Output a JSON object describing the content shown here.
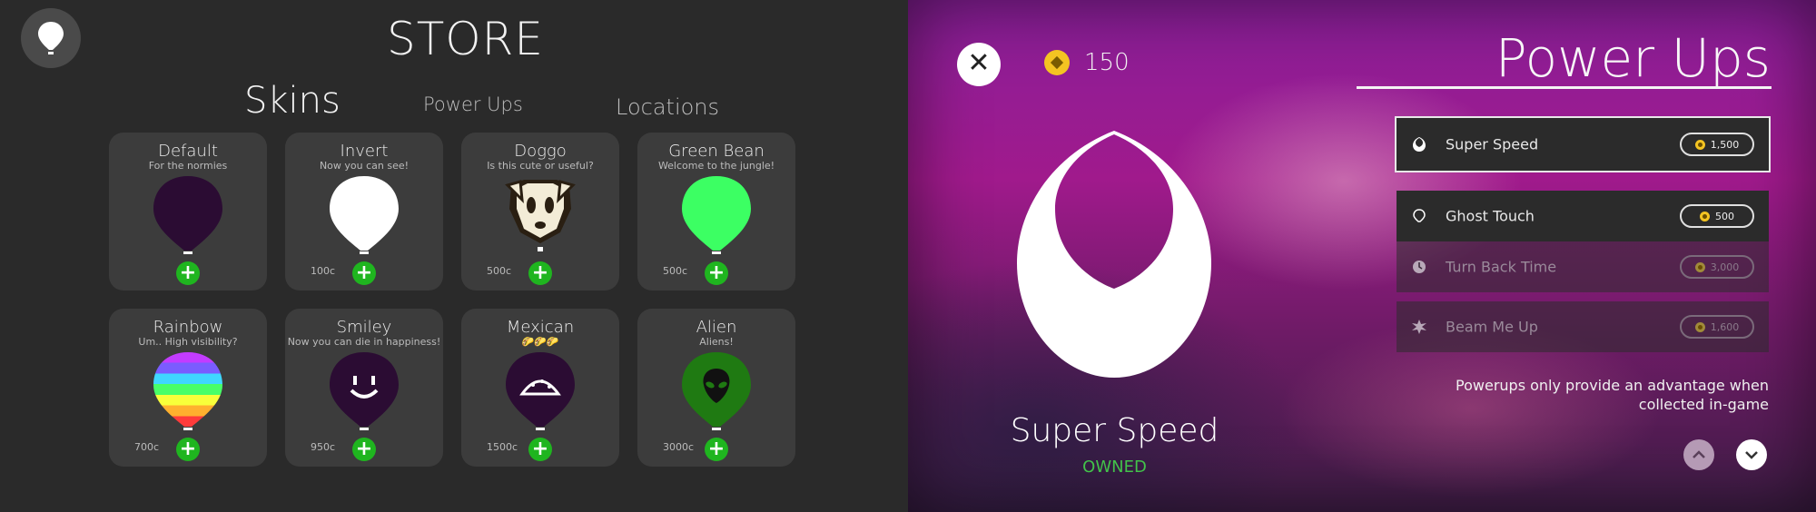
{
  "store": {
    "title": "STORE",
    "tabs": [
      "Skins",
      "Power Ups",
      "Locations"
    ],
    "skins": [
      {
        "name": "Default",
        "subtitle": "For the normies",
        "price": "",
        "color": "#2b0c33",
        "art": "plain"
      },
      {
        "name": "Invert",
        "subtitle": "Now you can see!",
        "price": "100c",
        "color": "#ffffff",
        "art": "plain"
      },
      {
        "name": "Doggo",
        "subtitle": "Is this cute or useful?",
        "price": "500c",
        "color": "#f3ecd7",
        "art": "dog-face-icon"
      },
      {
        "name": "Green Bean",
        "subtitle": "Welcome to the jungle!",
        "price": "500c",
        "color": "#3cff63",
        "art": "plain"
      },
      {
        "name": "Rainbow",
        "subtitle": "Um.. High visibility?",
        "price": "700c",
        "color": "#ff5b5b",
        "art": "rainbow"
      },
      {
        "name": "Smiley",
        "subtitle": "Now you can die in happiness!",
        "price": "950c",
        "color": "#2b0c33",
        "art": "smiley-face-icon"
      },
      {
        "name": "Mexican",
        "subtitle": "🌮🌮🌮",
        "price": "1500c",
        "color": "#2b0c33",
        "art": "taco-icon"
      },
      {
        "name": "Alien",
        "subtitle": "Aliens!",
        "price": "3000c",
        "color": "#1f7a12",
        "art": "alien-head-icon"
      }
    ],
    "add_label": "+"
  },
  "powerups": {
    "title": "Power Ups",
    "coins": "150",
    "close_label": "✕",
    "selected": {
      "name": "Super Speed",
      "status": "OWNED"
    },
    "items": [
      {
        "label": "Super Speed",
        "price": "1,500",
        "icon": "speed-drop-icon",
        "state": "selected"
      },
      {
        "label": "Ghost Touch",
        "price": "500",
        "icon": "ghost-balloon-icon",
        "state": "normal"
      },
      {
        "label": "Turn Back Time",
        "price": "3,000",
        "icon": "clock-icon",
        "state": "dim"
      },
      {
        "label": "Beam Me Up",
        "price": "1,600",
        "icon": "beam-burst-icon",
        "state": "dim"
      }
    ],
    "note": "Powerups only provide an advantage when collected in-game",
    "colors": {
      "owned": "#42c24a",
      "coin": "#f4c422",
      "add_button": "#1fb51f"
    }
  }
}
